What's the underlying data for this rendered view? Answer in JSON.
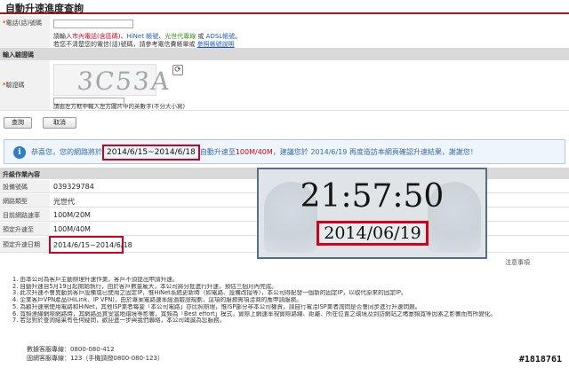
{
  "page": {
    "title": "自動升速進度查詢"
  },
  "form": {
    "phone_label": "電話(話)號碼",
    "phone_hint_parts": [
      "請輸入",
      "市內電話(含區碼)",
      "、",
      "HiNet 帳號",
      "、",
      "光世代專線",
      " 或 ",
      "ADSL帳號",
      "。"
    ],
    "phone_hint_line2": "若您不清楚您的電信(話)號碼，請參考電信費帳單或 ",
    "phone_hint_link": "參照帳號說明"
  },
  "captcha": {
    "section_title": "輸入驗證碼",
    "label": "驗證碼",
    "image_text": "3C53A",
    "refresh_icon": "refresh-icon",
    "hint": "請由左方框中輸入左方圖片中的英數字(不分大小寫)"
  },
  "buttons": {
    "query": "查詢",
    "cancel": "取消"
  },
  "notice": {
    "icon": "info-icon",
    "prefix": "恭喜您，您的網路將於",
    "dates": "2014/6/15~2014/6/18",
    "mid": "自動升速至",
    "speed": "100M/40M",
    "suffix": "，建議您於 2014/6/19 再度造訪本網頁確認升速結果，謝謝您！"
  },
  "details": {
    "section_title": "升級作業內容",
    "rows": [
      {
        "label": "設備號碼",
        "value": "039329784"
      },
      {
        "label": "網路類型",
        "value": "光世代"
      },
      {
        "label": "目前網路速率",
        "value": "100M/20M"
      },
      {
        "label": "預定升速至",
        "value": "100M/40M"
      },
      {
        "label": "預定升速日期",
        "value": "2014/6/15~2014/6/18"
      }
    ]
  },
  "clock": {
    "time": "21:57:50",
    "date": "2014/06/19"
  },
  "notes": {
    "label": "注意事項",
    "items": [
      "1.  由本公司為客戶主動辦理升速作業，客戶不須提出申請升速。",
      "2.  自動升速自5月19日起開始執行，由於客戶數量龐大，本公司將分批進行升速，預估三個月內完成。",
      "3.  此次升速不會異動到客戶設備或已使用之固定IP，惟HiNet系統更新時（如電路、設備改接等），本公司得配發一個新的固定IP，以取代原來的固定IP。",
      "4.  企業客戶VPN產品(HiLink、IP VPN)，由於專案電路速率經過驗證規劃，這項的服務需項洽商的應申請服務。",
      "5.  為顧升速需使用電路和HiNet，其他ISP業者每要「本公司電路」亦比照辦理，惟ISP部分非本公司權責，請自行電洽ISP業者詢問是否會同步進行升速問題。",
      "6.  寬頻連線網際網路時，其網路品質受當地環境等影響，寬頻為「Best effort」模式，實際上網速率視實際路線、距離、所在位置之環境及到訪網站之堵塞頻寬等因素之影響而有所變化。",
      "7.  若您對於查詢結果有任何疑問，歡迎進一步與我們聯絡，本公司竭誠為您服務。"
    ]
  },
  "contact": {
    "line1": "數據客服專線：0800-080-412",
    "line2": "固網客服專線：123（手機請撥0800-080-123）"
  },
  "watermark": "#1818761",
  "colors": {
    "accent_red": "#d0021b",
    "link_blue": "#1b5bb5",
    "notice_bg": "#eef5fb",
    "green": "#3a8d1c"
  }
}
